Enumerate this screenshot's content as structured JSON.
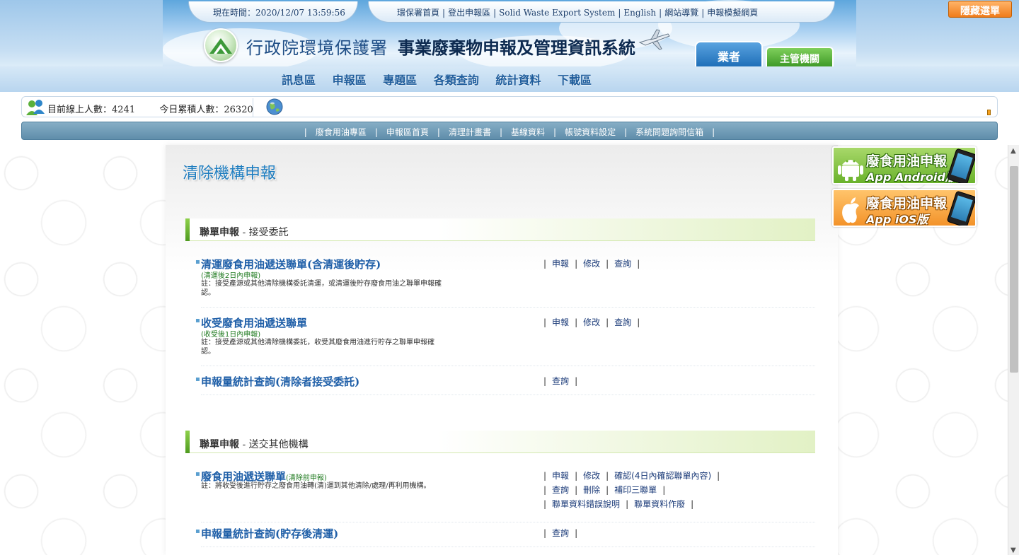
{
  "header": {
    "time_label": "現在時間：2020/12/07 13:59:56",
    "top_links": [
      "環保署首頁",
      "登出申報區",
      "Solid Waste Export System",
      "English",
      "網站導覽",
      "申報模擬網頁"
    ],
    "org_name": "行政院環境保護署",
    "system_name": "事業廢棄物申報及管理資訊系統",
    "tab_business": "業者",
    "tab_admin": "主管機關",
    "hide_menu": "隱藏選單"
  },
  "main_nav": [
    "訊息區",
    "申報區",
    "專題區",
    "各類查詢",
    "統計資料",
    "下載區"
  ],
  "stats": {
    "online_label": "目前線上人數：4241",
    "today_label": "今日累積人數：26320"
  },
  "sub_nav": [
    "廢食用油專區",
    "申報區首頁",
    "清理計畫書",
    "基線資料",
    "帳號資料設定",
    "系統問題詢問信箱"
  ],
  "page": {
    "title": "清除機構申報",
    "section1": {
      "bold": "聯單申報",
      "rest": " - 接受委託"
    },
    "section2": {
      "bold": "聯單申報",
      "rest": " - 送交其他機構"
    }
  },
  "items": [
    {
      "name": "清運廢食用油遞送聯單(含清運後貯存)",
      "deadline": "(清運後2日內申報)",
      "note": "註：接受產源或其他清除機構委託清運，或清運後貯存廢食用油之聯單申報確認。",
      "actions": [
        "申報",
        "修改",
        "查詢"
      ]
    },
    {
      "name": "收受廢食用油遞送聯單",
      "deadline": "(收受後1日內申報)",
      "note": "註：接受產源或其他清除機構委託，收受其廢食用油進行貯存之聯單申報確認。",
      "actions": [
        "申報",
        "修改",
        "查詢"
      ]
    },
    {
      "name": "申報量統計查詢(清除者接受委託)",
      "actions": [
        "查詢"
      ]
    },
    {
      "name": "廢食用油遞送聯單",
      "name_small": "(清除前申報)",
      "note": "註：將收受後進行貯存之廢食用油轉(清)運到其他清除/處理/再利用機構。",
      "actions_row1": [
        "申報",
        "修改",
        "確認(4日內確認聯單內容)"
      ],
      "actions_row2": [
        "查詢",
        "刪除",
        "補印三聯單"
      ],
      "actions_row3": [
        "聯單資料錯誤說明",
        "聯單資料作廢"
      ]
    },
    {
      "name": "申報量統計查詢(貯存後清運)",
      "actions": [
        "查詢"
      ]
    }
  ],
  "apps": {
    "android": {
      "title": "廢食用油申報",
      "sub": "App Android版"
    },
    "ios": {
      "title": "廢食用油申報",
      "sub": "App iOS版"
    }
  },
  "colors": {
    "link_blue": "#1f5fa8",
    "deadline_green": "#1f7a1f",
    "subnav_bg": "#6f9ab5",
    "hide_menu_orange": "#f07c1a"
  }
}
